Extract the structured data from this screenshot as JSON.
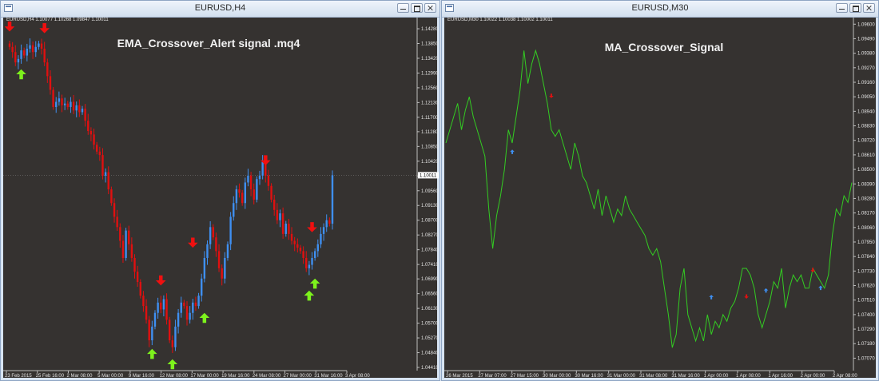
{
  "left_window": {
    "title": "EURUSD,H4",
    "header": "EURUSD,H4  1.10077 1.10268 1.09847 1.10011"
  },
  "right_window": {
    "title": "EURUSD,M30",
    "header": "EURUSD,M30  1.10022 1.10038 1.10002 1.10011"
  },
  "chart_data": [
    {
      "type": "candlestick",
      "title": "EMA_Crossover_Alert signal .mq4",
      "symbol": "EURUSD",
      "timeframe": "H4",
      "current_price": "1.10011",
      "ylim": [
        1.0441,
        1.1449
      ],
      "y_ticks": [
        "1.14280",
        "1.13850",
        "1.13420",
        "1.12990",
        "1.12560",
        "1.12130",
        "1.11700",
        "1.11280",
        "1.10850",
        "1.10420",
        "1.09990",
        "1.09560",
        "1.09130",
        "1.08700",
        "1.08270",
        "1.07840",
        "1.07410",
        "1.06990",
        "1.06560",
        "1.06130",
        "1.05700",
        "1.05270",
        "1.04840",
        "1.04410"
      ],
      "x_ticks": [
        "23 Feb 2015",
        "25 Feb 16:00",
        "2 Mar 08:00",
        "5 Mar 00:00",
        "9 Mar 16:00",
        "12 Mar 08:00",
        "17 Mar 00:00",
        "19 Mar 16:00",
        "24 Mar 08:00",
        "27 Mar 00:00",
        "31 Mar 16:00",
        "3 Apr 08:00"
      ],
      "bull_color": "#3f8ff0",
      "bear_color": "#e01010",
      "close_series": [
        1.1375,
        1.136,
        1.133,
        1.134,
        1.1365,
        1.135,
        1.137,
        1.138,
        1.136,
        1.1375,
        1.1385,
        1.137,
        1.133,
        1.129,
        1.125,
        1.12,
        1.1215,
        1.1225,
        1.1205,
        1.121,
        1.12,
        1.1215,
        1.119,
        1.1205,
        1.1185,
        1.1195,
        1.116,
        1.113,
        1.112,
        1.109,
        1.107,
        1.106,
        1.1,
        1.101,
        1.096,
        1.092,
        1.088,
        1.085,
        1.081,
        1.076,
        1.084,
        1.08,
        1.076,
        1.072,
        1.069,
        1.065,
        1.062,
        1.058,
        1.052,
        1.056,
        1.06,
        1.063,
        1.061,
        1.064,
        1.058,
        1.052,
        1.05,
        1.056,
        1.06,
        1.063,
        1.062,
        1.058,
        1.06,
        1.063,
        1.062,
        1.065,
        1.07,
        1.076,
        1.08,
        1.085,
        1.082,
        1.078,
        1.073,
        1.07,
        1.076,
        1.08,
        1.088,
        1.092,
        1.096,
        1.095,
        1.092,
        1.098,
        1.1,
        1.096,
        1.093,
        1.099,
        1.1,
        1.104,
        1.1,
        1.097,
        1.093,
        1.09,
        1.087,
        1.089,
        1.083,
        1.086,
        1.083,
        1.081,
        1.08,
        1.079,
        1.078,
        1.076,
        1.073,
        1.074,
        1.076,
        1.078,
        1.08,
        1.083,
        1.085,
        1.087,
        1.086,
        1.1001
      ],
      "buy_arrows": [
        {
          "bar": 4,
          "price": 1.131
        },
        {
          "bar": 49,
          "price": 1.0495
        },
        {
          "bar": 56,
          "price": 1.0465
        },
        {
          "bar": 67,
          "price": 1.06
        },
        {
          "bar": 103,
          "price": 1.0665
        },
        {
          "bar": 105,
          "price": 1.07
        }
      ],
      "sell_arrows": [
        {
          "bar": 0,
          "price": 1.142
        },
        {
          "bar": 12,
          "price": 1.1415
        },
        {
          "bar": 52,
          "price": 1.068
        },
        {
          "bar": 63,
          "price": 1.079
        },
        {
          "bar": 88,
          "price": 1.103
        },
        {
          "bar": 104,
          "price": 1.0835
        }
      ]
    },
    {
      "type": "line",
      "title": "MA_Crossover_Signal",
      "symbol": "EURUSD",
      "timeframe": "M30",
      "line_color": "#33cc22",
      "ylim": [
        1.07,
        1.0965
      ],
      "y_ticks": [
        "1.09600",
        "1.09490",
        "1.09380",
        "1.09270",
        "1.09160",
        "1.09050",
        "1.08940",
        "1.08830",
        "1.08720",
        "1.08610",
        "1.08500",
        "1.08390",
        "1.08280",
        "1.08170",
        "1.08060",
        "1.07950",
        "1.07840",
        "1.07730",
        "1.07620",
        "1.07510",
        "1.07400",
        "1.07290",
        "1.07180",
        "1.07070"
      ],
      "x_ticks": [
        "26 Mar 2015",
        "27 Mar 07:00",
        "27 Mar 15:00",
        "30 Mar 00:00",
        "30 Mar 16:00",
        "31 Mar 00:00",
        "31 Mar 08:00",
        "31 Mar 16:00",
        "1 Apr 00:00",
        "1 Apr 08:00",
        "1 Apr 16:00",
        "2 Apr 00:00",
        "2 Apr 08:00"
      ],
      "series": [
        {
          "values": [
            1.087,
            1.088,
            1.089,
            1.09,
            1.088,
            1.0895,
            1.0905,
            1.089,
            1.088,
            1.087,
            1.086,
            1.082,
            1.079,
            1.0815,
            1.083,
            1.085,
            1.088,
            1.087,
            1.089,
            1.091,
            1.094,
            1.0915,
            1.093,
            1.094,
            1.093,
            1.0915,
            1.09,
            1.088,
            1.0875,
            1.088,
            1.087,
            1.086,
            1.085,
            1.087,
            1.086,
            1.0845,
            1.084,
            1.083,
            1.082,
            1.0835,
            1.0815,
            1.083,
            1.082,
            1.081,
            1.082,
            1.0815,
            1.083,
            1.082,
            1.0815,
            1.081,
            1.0805,
            1.08,
            1.079,
            1.0785,
            1.079,
            1.078,
            1.076,
            1.074,
            1.0715,
            1.0725,
            1.076,
            1.0775,
            1.074,
            1.073,
            1.072,
            1.073,
            1.072,
            1.074,
            1.0725,
            1.0735,
            1.073,
            1.074,
            1.0735,
            1.0745,
            1.075,
            1.076,
            1.0775,
            1.0775,
            1.077,
            1.076,
            1.074,
            1.073,
            1.074,
            1.075,
            1.0765,
            1.076,
            1.0775,
            1.0745,
            1.076,
            1.077,
            1.0765,
            1.077,
            1.076,
            1.076,
            1.0775,
            1.077,
            1.0765,
            1.076,
            1.077,
            1.08,
            1.082,
            1.0815,
            1.083,
            1.0825,
            1.084
          ]
        }
      ],
      "buy_arrows": [
        {
          "index": 17,
          "price": 1.0865
        },
        {
          "index": 68,
          "price": 1.0755
        },
        {
          "index": 82,
          "price": 1.076
        },
        {
          "index": 96,
          "price": 1.0762
        }
      ],
      "sell_arrows": [
        {
          "index": 27,
          "price": 1.0904
        },
        {
          "index": 77,
          "price": 1.0752
        },
        {
          "index": 94,
          "price": 1.0772
        }
      ]
    }
  ]
}
